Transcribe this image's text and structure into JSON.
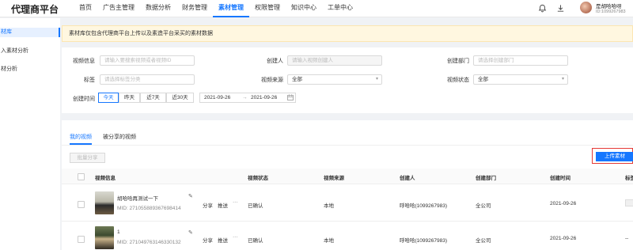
{
  "app": {
    "title": "代理商平台"
  },
  "nav": {
    "items": [
      {
        "label": "首页",
        "active": false
      },
      {
        "label": "广告主管理",
        "active": false
      },
      {
        "label": "数据分析",
        "active": false
      },
      {
        "label": "财务管理",
        "active": false
      },
      {
        "label": "素材管理",
        "active": true
      },
      {
        "label": "权限管理",
        "active": false
      },
      {
        "label": "知识中心",
        "active": false
      },
      {
        "label": "工单中心",
        "active": false
      }
    ]
  },
  "user": {
    "name": "是胡哈哈呀",
    "id": "ID:1099267983"
  },
  "sidebar": {
    "items": [
      {
        "label": "材库",
        "active": true
      },
      {
        "label": "入素材分析",
        "active": false
      },
      {
        "label": "材分析",
        "active": false
      }
    ]
  },
  "notice": {
    "text": "素材库仅包含代理商平台上传以及素造平台采买的素材数据"
  },
  "filters": {
    "video_info": {
      "label": "视频信息",
      "placeholder": "请输入要搜索视频或者视频ID"
    },
    "creator": {
      "label": "创建人",
      "placeholder": "请输入视频创建人"
    },
    "department": {
      "label": "创建部门",
      "placeholder": "请选择创建部门"
    },
    "tags": {
      "label": "标签",
      "placeholder": "请选择标签分类"
    },
    "source": {
      "label": "视频来源",
      "value": "全部"
    },
    "status": {
      "label": "视频状态",
      "value": "全部"
    },
    "time": {
      "label": "创建时间",
      "quick": [
        "今天",
        "昨天",
        "近7天",
        "近30天"
      ],
      "active_index": 0,
      "start": "2021-09-26",
      "end": "2021-09-26",
      "separator": "→"
    }
  },
  "tabs": [
    {
      "label": "我的视频",
      "active": true
    },
    {
      "label": "被分享的视频",
      "active": false
    }
  ],
  "actions": {
    "batch_share": "批量分享",
    "upload": "上传素材"
  },
  "table": {
    "headers": [
      "视频信息",
      "视频状态",
      "视频来源",
      "创建人",
      "创建部门",
      "创建时间",
      "标签"
    ],
    "rows": [
      {
        "title": "胡哈哈再测试一下",
        "mid": "MID: 271055889367698414",
        "actions": [
          "分享",
          "推送",
          "···"
        ],
        "status": "已确认",
        "source": "本地",
        "creator": "呼哈哈(1099267983)",
        "department": "全公司",
        "created": "2021-09-26",
        "tag": ""
      },
      {
        "title": "1",
        "mid": "MID: 271049763146330132",
        "actions": [
          "分享",
          "推送",
          "···"
        ],
        "status": "已确认",
        "source": "本地",
        "creator": "呼哈哈(1099267983)",
        "department": "全公司",
        "created": "2021-09-26",
        "tag": "--"
      }
    ]
  },
  "icons": {
    "bell": "bell-icon",
    "download": "download-icon",
    "edit": "edit-icon",
    "calendar": "calendar-icon"
  },
  "colors": {
    "accent": "#1677ff",
    "notice_bg": "#fff7e0",
    "highlight_border": "#e53935"
  }
}
